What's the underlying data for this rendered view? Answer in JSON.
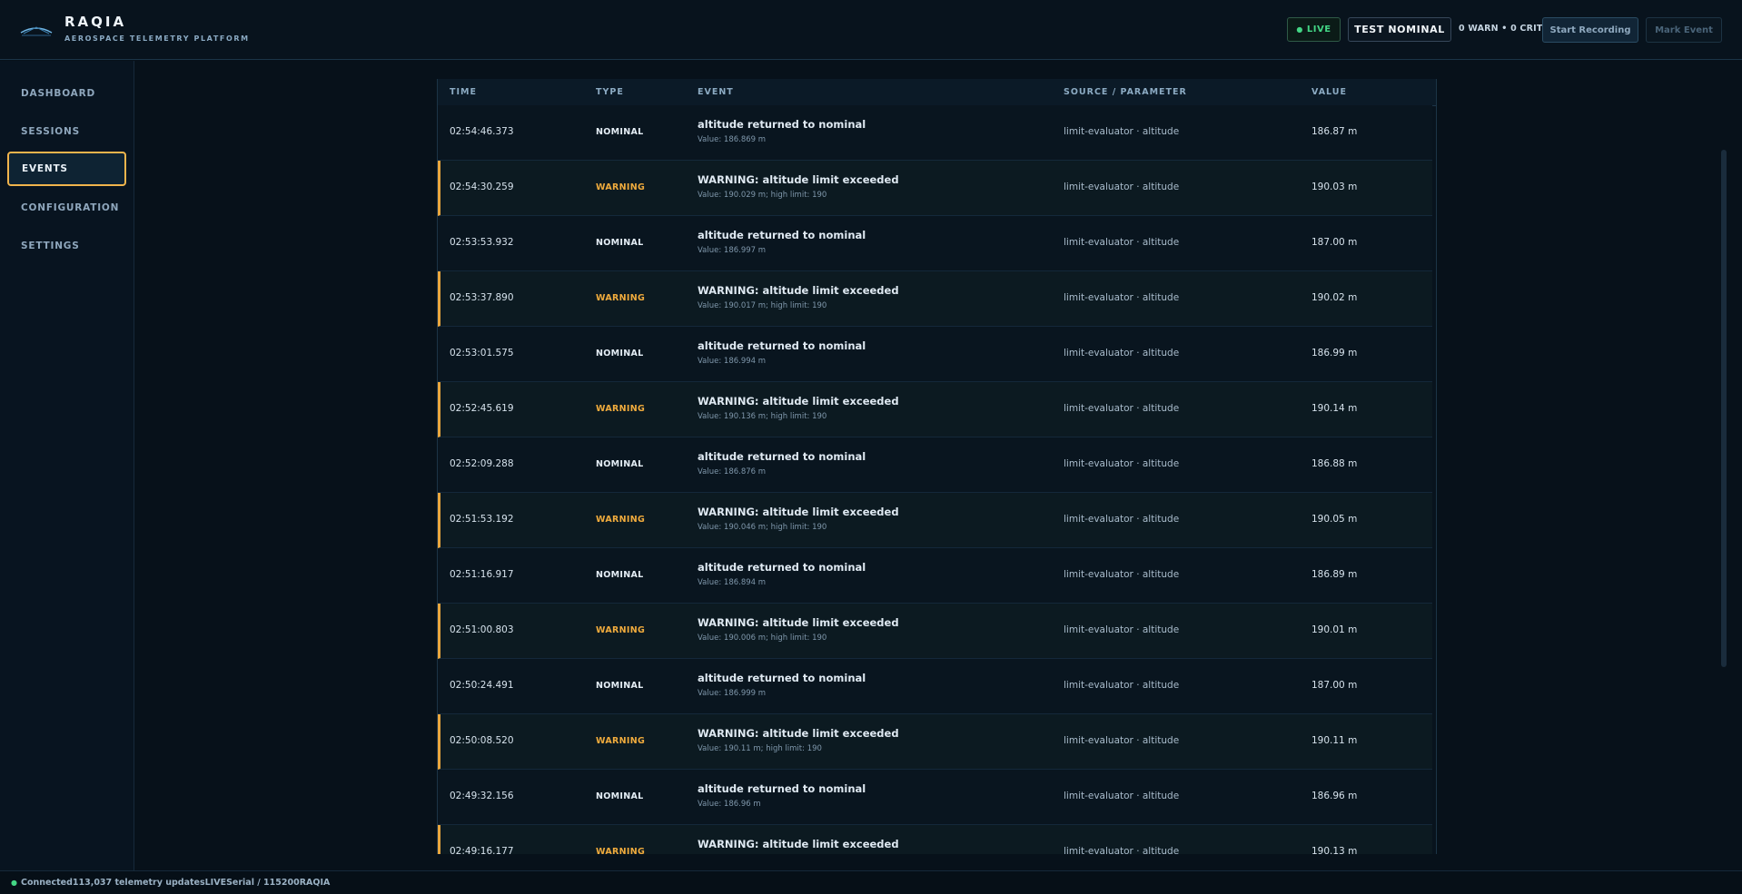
{
  "app": {
    "title": "RAQIA",
    "subtitle": "AEROSPACE TELEMETRY PLATFORM",
    "logo_icon": "wing-logo-icon"
  },
  "header": {
    "live_label": "LIVE",
    "status_label": "TEST NOMINAL",
    "alarm_counts": "0 WARN • 0 CRIT",
    "start_recording_label": "Start Recording",
    "mark_event_label": "Mark Event",
    "live_color": "#43d685",
    "accent_color": "#f0b44c"
  },
  "sidebar": {
    "items": [
      {
        "label": "DASHBOARD",
        "active": false
      },
      {
        "label": "SESSIONS",
        "active": false
      },
      {
        "label": "EVENTS",
        "active": true
      },
      {
        "label": "CONFIGURATION",
        "active": false
      },
      {
        "label": "SETTINGS",
        "active": false
      }
    ]
  },
  "events_table": {
    "columns": [
      "TIME",
      "TYPE",
      "EVENT",
      "SOURCE / PARAMETER",
      "VALUE"
    ],
    "rows": [
      {
        "time": "02:54:46.373",
        "type": "NOMINAL",
        "title": "altitude returned to nominal",
        "detail": "Value: 186.869 m",
        "source": "limit-evaluator · altitude",
        "value": "186.87 m"
      },
      {
        "time": "02:54:30.259",
        "type": "WARNING",
        "title": "WARNING: altitude limit exceeded",
        "detail": "Value: 190.029 m; high limit: 190",
        "source": "limit-evaluator · altitude",
        "value": "190.03 m"
      },
      {
        "time": "02:53:53.932",
        "type": "NOMINAL",
        "title": "altitude returned to nominal",
        "detail": "Value: 186.997 m",
        "source": "limit-evaluator · altitude",
        "value": "187.00 m"
      },
      {
        "time": "02:53:37.890",
        "type": "WARNING",
        "title": "WARNING: altitude limit exceeded",
        "detail": "Value: 190.017 m; high limit: 190",
        "source": "limit-evaluator · altitude",
        "value": "190.02 m"
      },
      {
        "time": "02:53:01.575",
        "type": "NOMINAL",
        "title": "altitude returned to nominal",
        "detail": "Value: 186.994 m",
        "source": "limit-evaluator · altitude",
        "value": "186.99 m"
      },
      {
        "time": "02:52:45.619",
        "type": "WARNING",
        "title": "WARNING: altitude limit exceeded",
        "detail": "Value: 190.136 m; high limit: 190",
        "source": "limit-evaluator · altitude",
        "value": "190.14 m"
      },
      {
        "time": "02:52:09.288",
        "type": "NOMINAL",
        "title": "altitude returned to nominal",
        "detail": "Value: 186.876 m",
        "source": "limit-evaluator · altitude",
        "value": "186.88 m"
      },
      {
        "time": "02:51:53.192",
        "type": "WARNING",
        "title": "WARNING: altitude limit exceeded",
        "detail": "Value: 190.046 m; high limit: 190",
        "source": "limit-evaluator · altitude",
        "value": "190.05 m"
      },
      {
        "time": "02:51:16.917",
        "type": "NOMINAL",
        "title": "altitude returned to nominal",
        "detail": "Value: 186.894 m",
        "source": "limit-evaluator · altitude",
        "value": "186.89 m"
      },
      {
        "time": "02:51:00.803",
        "type": "WARNING",
        "title": "WARNING: altitude limit exceeded",
        "detail": "Value: 190.006 m; high limit: 190",
        "source": "limit-evaluator · altitude",
        "value": "190.01 m"
      },
      {
        "time": "02:50:24.491",
        "type": "NOMINAL",
        "title": "altitude returned to nominal",
        "detail": "Value: 186.999 m",
        "source": "limit-evaluator · altitude",
        "value": "187.00 m"
      },
      {
        "time": "02:50:08.520",
        "type": "WARNING",
        "title": "WARNING: altitude limit exceeded",
        "detail": "Value: 190.11 m; high limit: 190",
        "source": "limit-evaluator · altitude",
        "value": "190.11 m"
      },
      {
        "time": "02:49:32.156",
        "type": "NOMINAL",
        "title": "altitude returned to nominal",
        "detail": "Value: 186.96 m",
        "source": "limit-evaluator · altitude",
        "value": "186.96 m"
      },
      {
        "time": "02:49:16.177",
        "type": "WARNING",
        "title": "WARNING: altitude limit exceeded",
        "detail": "",
        "source": "limit-evaluator · altitude",
        "value": "190.13 m"
      }
    ]
  },
  "footer": {
    "connection": "Connected",
    "updates": "113,037 telemetry updates",
    "live": "LIVE",
    "serial": "Serial / 115200",
    "app": "RAQIA"
  }
}
